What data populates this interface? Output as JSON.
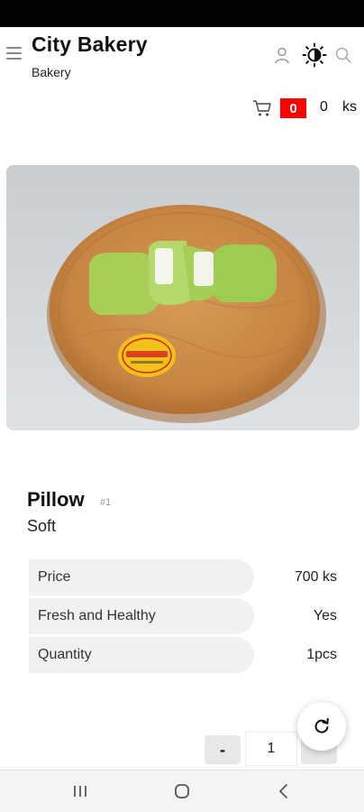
{
  "header": {
    "title": "City Bakery",
    "subtitle": "Bakery"
  },
  "icons": [
    "menu-icon",
    "user-icon",
    "brightness-icon",
    "search-icon",
    "cart-icon",
    "refresh-icon"
  ],
  "cart": {
    "count": "0",
    "total": "0",
    "unit": "ks"
  },
  "product": {
    "name": "Pillow",
    "id": "#1",
    "description": "Soft",
    "specs": [
      {
        "label": "Price",
        "value": "700 ks"
      },
      {
        "label": "Fresh and Healthy",
        "value": "Yes"
      },
      {
        "label": "Quantity",
        "value": "1pcs"
      }
    ]
  },
  "quantity": {
    "minus_label": "-",
    "value": "1"
  },
  "colors": {
    "cart_badge": "#ff0000",
    "status_bar": "#000000",
    "spec_pill": "#f1f1f1"
  }
}
